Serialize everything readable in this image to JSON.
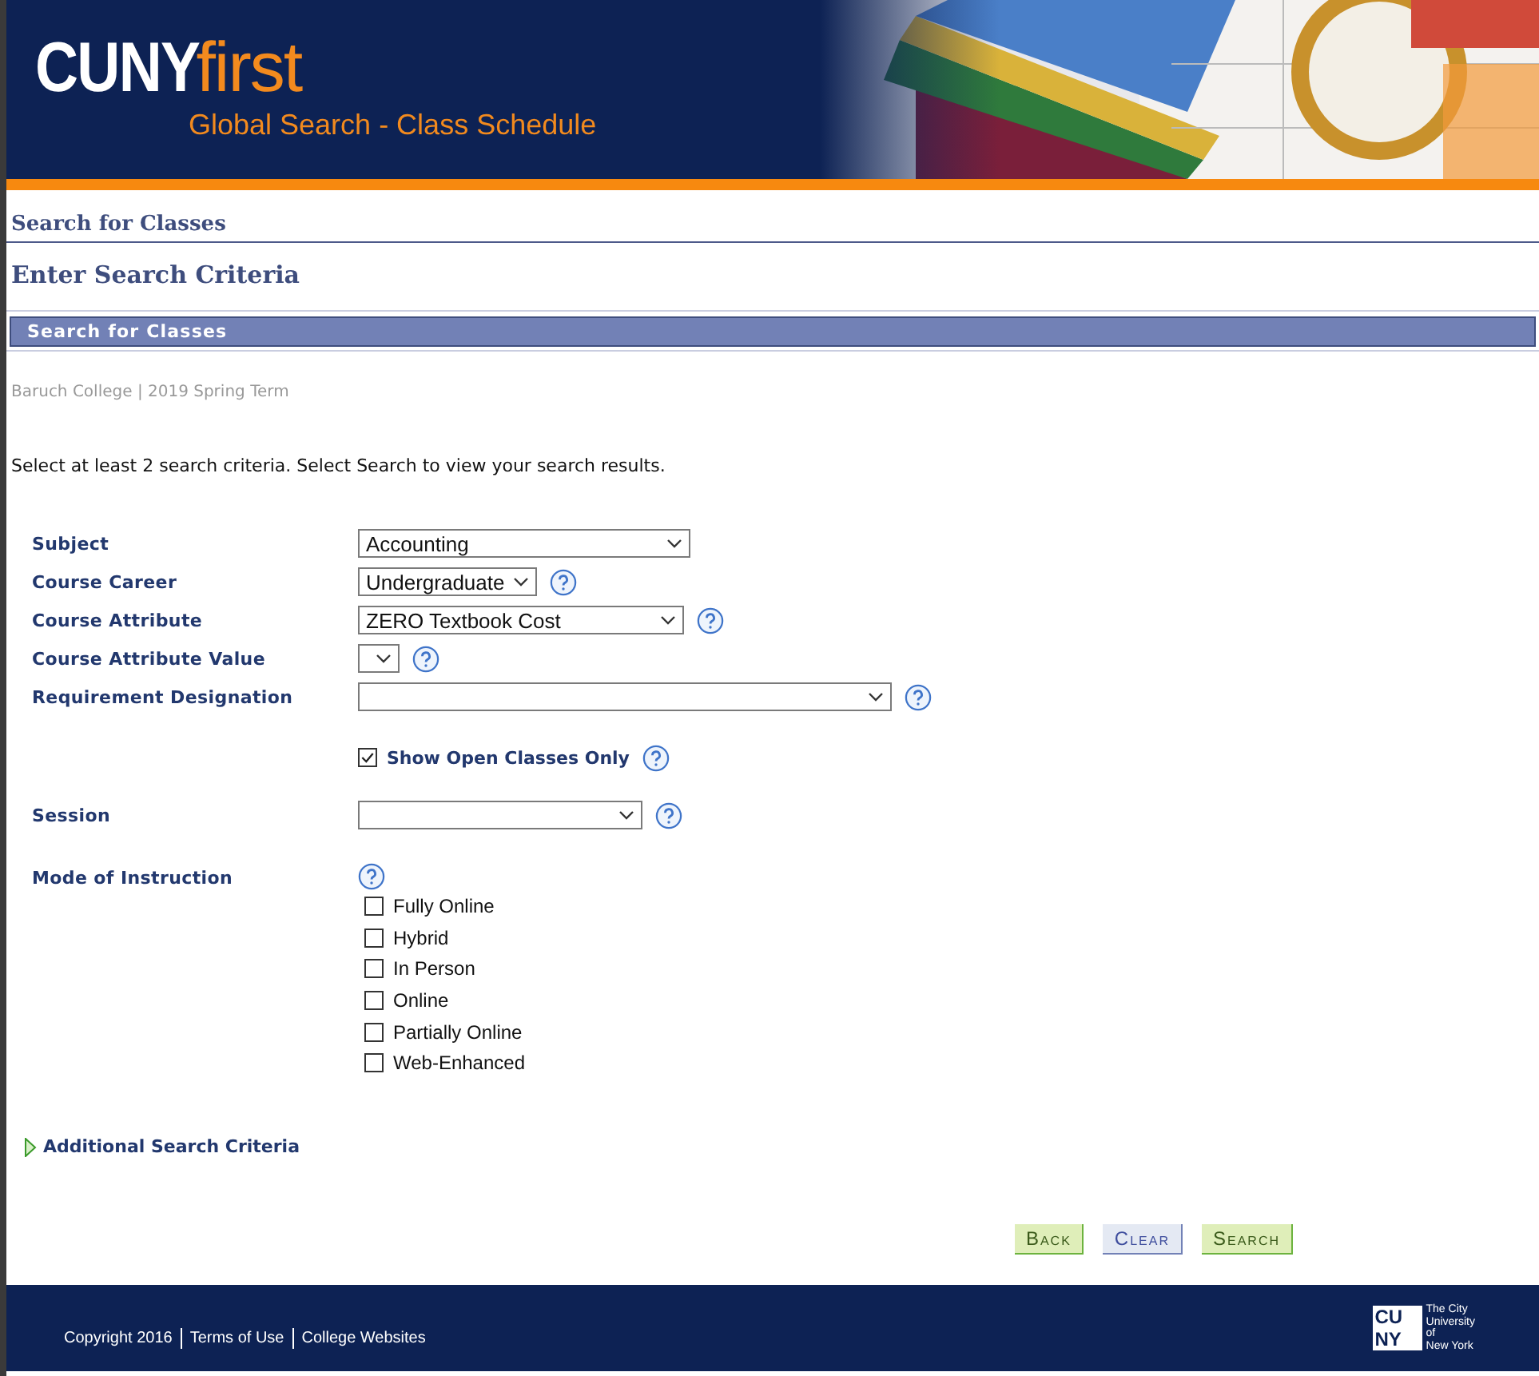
{
  "header": {
    "logo_main": "CUNY",
    "logo_accent": "first",
    "subtitle": "Global Search - Class Schedule"
  },
  "page_title": "Search for Classes",
  "section_title": "Enter Search Criteria",
  "group_bar": "Search for Classes",
  "context": "Baruch College | 2019 Spring Term",
  "instructions": "Select at least 2 search criteria. Select Search to view your search results.",
  "criteria": [
    {
      "kind": "select",
      "label": "Subject",
      "value": "Accounting",
      "help": false
    },
    {
      "kind": "select",
      "label": "Course Career",
      "value": "Undergraduate",
      "help": true
    },
    {
      "kind": "select",
      "label": "Course Attribute",
      "value": "ZERO Textbook Cost",
      "help": true
    },
    {
      "kind": "select",
      "label": "Course Attribute Value",
      "help": true
    },
    {
      "kind": "select",
      "label": "Requirement Designation",
      "help": true
    },
    {
      "kind": "checkbox",
      "label": "Show Open Classes Only",
      "checked": true,
      "help": true
    },
    {
      "kind": "select",
      "label": "Session",
      "help": true
    },
    {
      "kind": "checkgroup",
      "label": "Mode of Instruction",
      "help": true,
      "options": [
        {
          "label": "Fully Online",
          "checked": false
        },
        {
          "label": "Hybrid",
          "checked": false
        },
        {
          "label": "In Person",
          "checked": false
        },
        {
          "label": "Online",
          "checked": false
        },
        {
          "label": "Partially Online",
          "checked": false
        },
        {
          "label": "Web-Enhanced",
          "checked": false
        }
      ]
    }
  ],
  "additional": {
    "label": "Additional Search Criteria",
    "expanded": false
  },
  "buttons": [
    {
      "label": "Back",
      "kind": "green"
    },
    {
      "label": "Clear",
      "kind": "blue"
    },
    {
      "label": "Search",
      "kind": "green"
    }
  ],
  "footer": {
    "links": [
      "Copyright 2016",
      "Terms of Use",
      "College Websites"
    ],
    "logo_top": "CU",
    "logo_bottom": "NY",
    "logo_text": [
      "The City",
      "University",
      "of",
      "New York"
    ]
  }
}
